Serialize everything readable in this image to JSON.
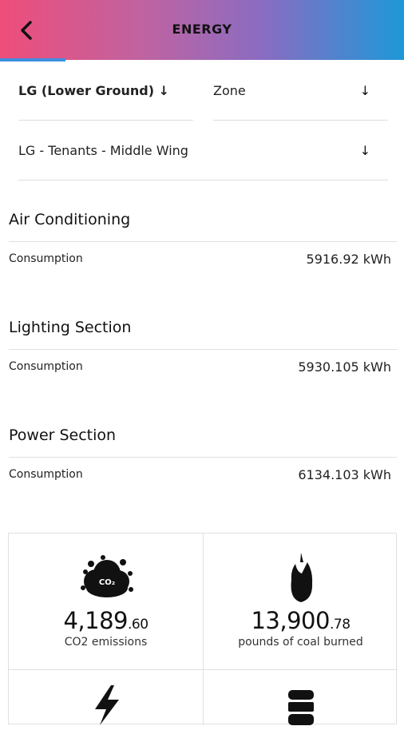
{
  "header": {
    "title": "ENERGY"
  },
  "filters": {
    "floor": "LG (Lower Ground) ↓",
    "zone": "Zone",
    "zone_arrow": "↓",
    "area": "LG - Tenants - Middle Wing",
    "area_arrow": "↓"
  },
  "sections": [
    {
      "title": "Air Conditioning",
      "label": "Consumption",
      "value": "5916.92 kWh"
    },
    {
      "title": "Lighting Section",
      "label": "Consumption",
      "value": "5930.105 kWh"
    },
    {
      "title": "Power Section",
      "label": "Consumption",
      "value": "6134.103 kWh"
    }
  ],
  "stats": [
    {
      "whole": "4,189",
      "dec": ".60",
      "caption": "CO2 emissions",
      "icon": "co2-cloud-icon"
    },
    {
      "whole": "13,900",
      "dec": ".78",
      "caption": "pounds of coal burned",
      "icon": "coal-flame-icon"
    }
  ]
}
